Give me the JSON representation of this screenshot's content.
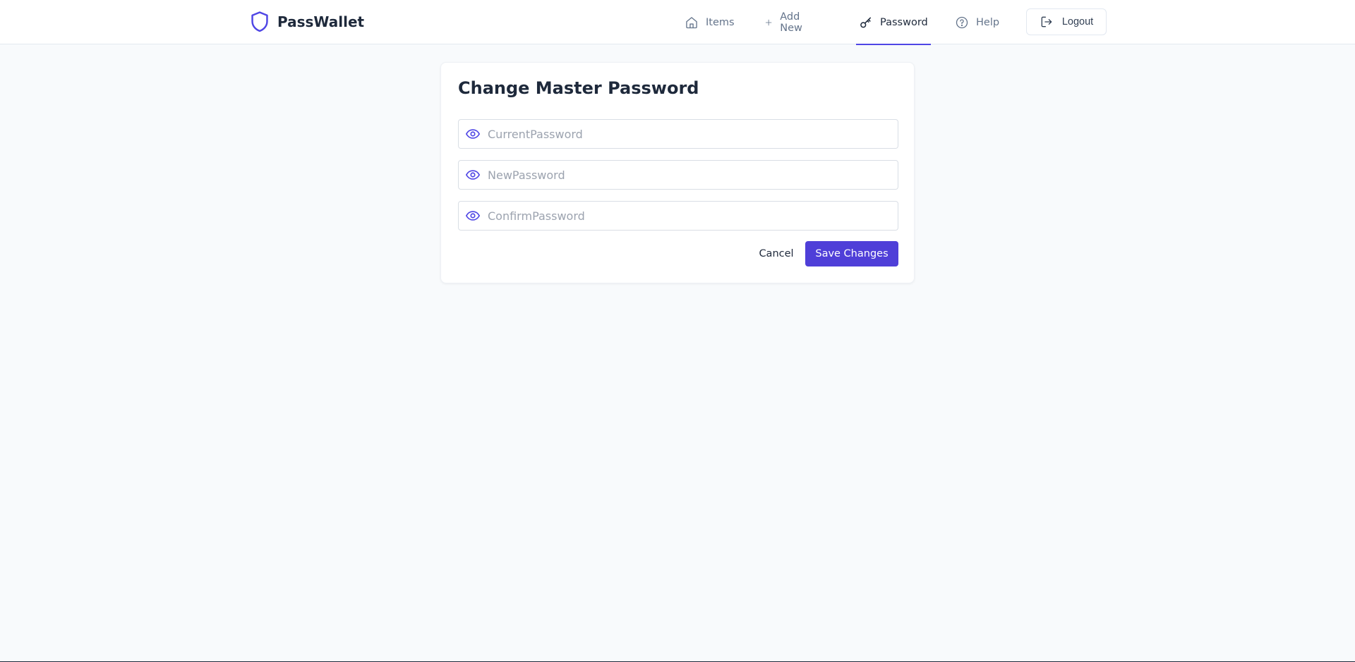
{
  "brand": {
    "name": "PassWallet",
    "icon": "shield-icon"
  },
  "nav": {
    "items": [
      {
        "label": "Items",
        "icon": "home-icon"
      },
      {
        "label": "Add New",
        "icon": "plus-icon"
      },
      {
        "label": "Password",
        "icon": "key-icon",
        "active": true
      },
      {
        "label": "Help",
        "icon": "help-circle-icon"
      }
    ],
    "logout_label": "Logout"
  },
  "form": {
    "title": "Change Master Password",
    "fields": [
      {
        "placeholder": "CurrentPassword",
        "value": ""
      },
      {
        "placeholder": "NewPassword",
        "value": ""
      },
      {
        "placeholder": "ConfirmPassword",
        "value": ""
      }
    ],
    "cancel_label": "Cancel",
    "save_label": "Save Changes"
  },
  "colors": {
    "accent": "#4f46e5",
    "primary_button": "#4f3fd8",
    "background": "#f8fafc"
  }
}
